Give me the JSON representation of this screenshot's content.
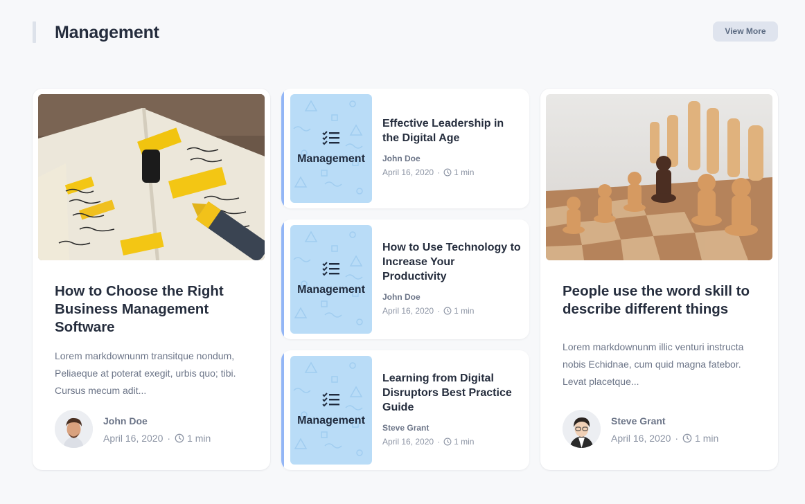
{
  "header": {
    "title": "Management",
    "view_more_label": "View More"
  },
  "featured_left": {
    "image_icon": "notebook-photo",
    "title": "How to Choose the Right Business Management Software",
    "excerpt": "Lorem markdownunm transitque nondum, Peliaeque at poterat exegit, urbis quo; tibi. Cursus mecum adit...",
    "author": "John Doe",
    "date": "April 16, 2020",
    "separator": "·",
    "read_time": "1 min"
  },
  "featured_right": {
    "image_icon": "chess-photo",
    "title": "People use the word skill to describe different things",
    "excerpt": "Lorem markdownunm illic venturi instructa nobis Echidnae, cum quid magna fatebor. Levat placetque...",
    "author": "Steve Grant",
    "date": "April 16, 2020",
    "separator": "·",
    "read_time": "1 min"
  },
  "list_posts": [
    {
      "category": "Management",
      "icon": "checklist-icon",
      "title": "Effective Leadership in the Digital Age",
      "author": "John Doe",
      "date": "April 16, 2020",
      "separator": "·",
      "read_time": "1 min"
    },
    {
      "category": "Management",
      "icon": "checklist-icon",
      "title": "How to Use Technology to Increase Your Productivity",
      "author": "John Doe",
      "date": "April 16, 2020",
      "separator": "·",
      "read_time": "1 min"
    },
    {
      "category": "Management",
      "icon": "checklist-icon",
      "title": "Learning from Digital Disruptors Best Practice Guide",
      "author": "Steve Grant",
      "date": "April 16, 2020",
      "separator": "·",
      "read_time": "1 min"
    }
  ],
  "colors": {
    "background": "#f7f8fa",
    "accent": "#93b6f6",
    "thumb": "#b9dcf7",
    "button_bg": "#dfe4ee"
  }
}
